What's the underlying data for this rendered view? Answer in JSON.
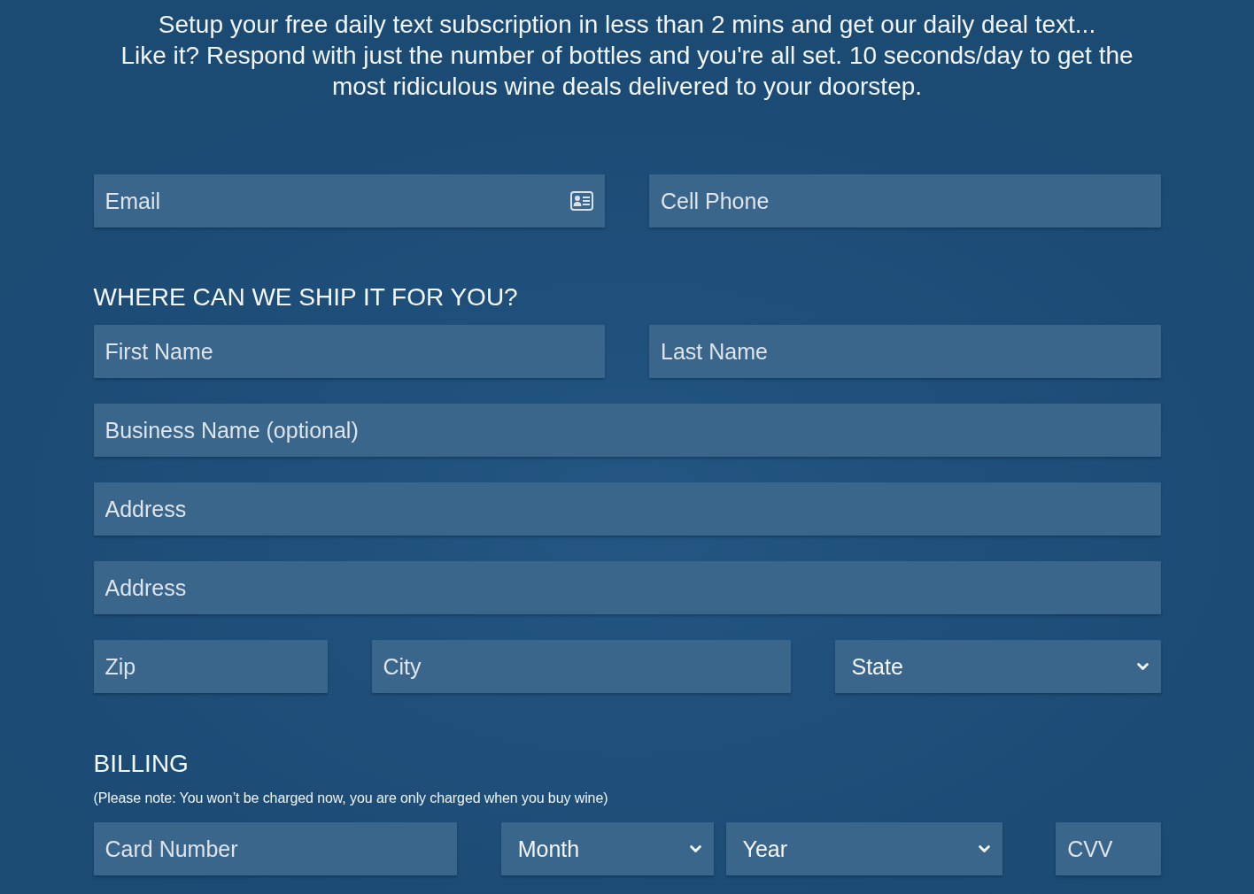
{
  "intro": [
    "Setup your free daily text subscription in less than 2 mins and get our daily deal text...",
    "Like it? Respond with just the number of bottles and you're all set. 10 seconds/day to get the most ridiculous wine deals delivered to your doorstep."
  ],
  "contact_fields": [
    {
      "kind": "email",
      "placeholder": "Email"
    },
    {
      "kind": "text",
      "placeholder": "Cell Phone"
    }
  ],
  "shipping": {
    "heading": "WHERE CAN WE SHIP IT FOR YOU?",
    "rows": [
      [
        {
          "kind": "text",
          "placeholder": "First Name"
        },
        {
          "kind": "text",
          "placeholder": "Last Name"
        }
      ],
      [
        {
          "kind": "text",
          "placeholder": "Business Name (optional)"
        }
      ],
      [
        {
          "kind": "text",
          "placeholder": "Address"
        }
      ],
      [
        {
          "kind": "text",
          "placeholder": "Address"
        }
      ],
      [
        {
          "kind": "text",
          "placeholder": "Zip"
        },
        {
          "kind": "text",
          "placeholder": "City"
        },
        {
          "kind": "select",
          "value": "State"
        }
      ]
    ]
  },
  "billing": {
    "heading": "BILLING",
    "note": "(Please note: You won’t be charged now, you are only charged when you buy wine)",
    "rows": [
      [
        {
          "kind": "text",
          "placeholder": "Card Number"
        },
        {
          "kind": "select",
          "value": "Month"
        },
        {
          "kind": "select",
          "value": "Year"
        },
        {
          "kind": "text",
          "placeholder": "CVV"
        }
      ]
    ]
  }
}
